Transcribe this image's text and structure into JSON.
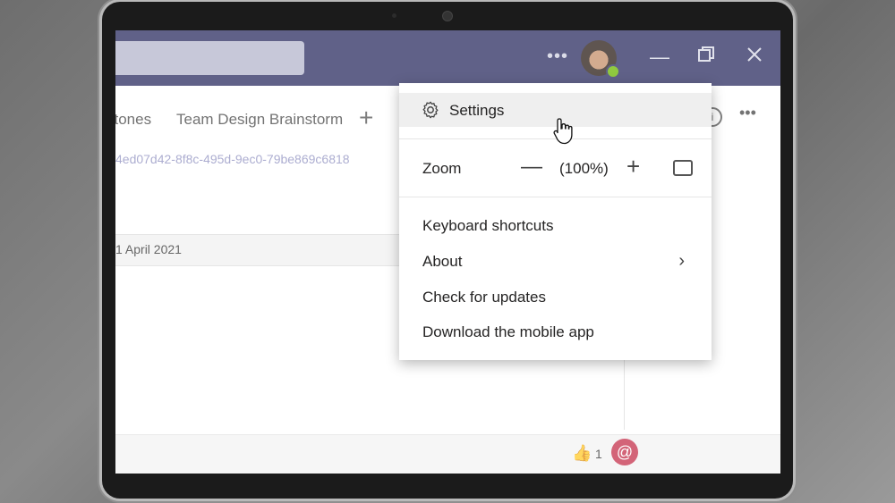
{
  "tabs": [
    "stones",
    "Team Design Brainstorm"
  ],
  "guid_text": "4ed07d42-8f8c-495d-9ec0-79be869c6818",
  "date_text": "1 April 2021",
  "reaction_count": "1",
  "menu": {
    "settings": "Settings",
    "zoom_label": "Zoom",
    "zoom_value": "(100%)",
    "keyboard_shortcuts": "Keyboard shortcuts",
    "about": "About",
    "check_updates": "Check for updates",
    "download_app": "Download the mobile app"
  },
  "icons": {
    "more": "more-icon",
    "gear": "gear-icon",
    "minimize": "minimize-icon",
    "restore": "restore-icon",
    "close": "close-icon",
    "plus": "plus-icon",
    "minus": "minus-icon",
    "fullscreen": "fullscreen-icon",
    "chevron": "chevron-right-icon",
    "info": "info-icon",
    "thumbs_up": "thumbs-up-icon",
    "mention": "at-mention-icon"
  },
  "colors": {
    "titlebar": "#2b2d61",
    "accent": "#6264a7",
    "presence": "#6bb700",
    "mention": "#c4314b"
  }
}
